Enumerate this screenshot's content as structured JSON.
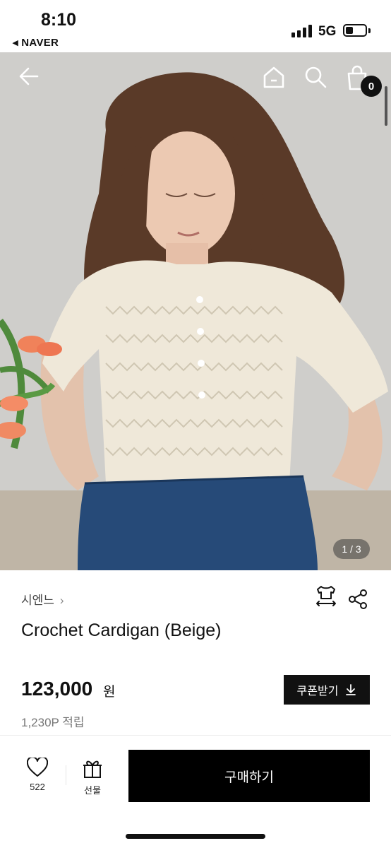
{
  "status_bar": {
    "time": "8:10",
    "back_app": "◂ NAVER",
    "network": "5G"
  },
  "header": {
    "cart_count": "0"
  },
  "gallery": {
    "page_indicator": "1 / 3"
  },
  "product": {
    "brand": "시엔느",
    "brand_chevron": "›",
    "title": "Crochet Cardigan (Beige)",
    "price": "123,000",
    "currency": "원",
    "points": "1,230P 적립"
  },
  "coupon": {
    "label": "쿠폰받기"
  },
  "bottom_bar": {
    "like_count": "522",
    "gift_label": "선물",
    "buy_label": "구매하기"
  },
  "icons": [
    "back-arrow-icon",
    "home-icon",
    "search-icon",
    "cart-icon",
    "size-guide-icon",
    "share-icon",
    "download-icon",
    "heart-icon",
    "gift-icon"
  ]
}
